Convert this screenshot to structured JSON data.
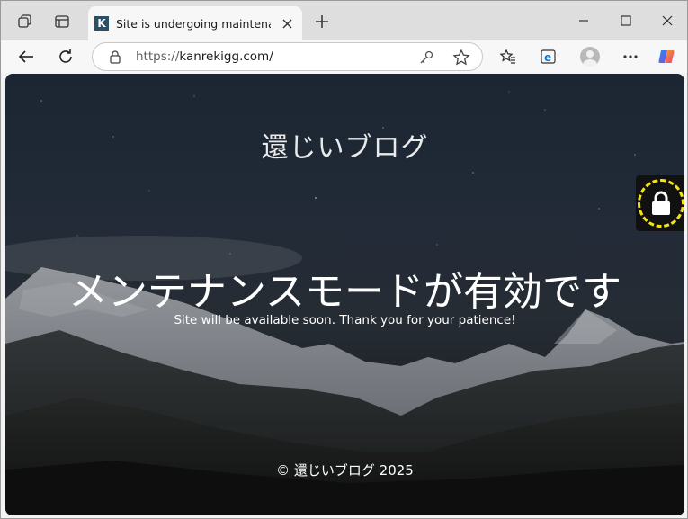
{
  "browser": {
    "tab": {
      "favicon_letter": "K",
      "title": "Site is undergoing maintenance"
    },
    "url_protocol": "https://",
    "url_host": "kanrekigg.com/"
  },
  "page": {
    "site_title": "還じいブログ",
    "headline": "メンテナンスモードが有効です",
    "subline": "Site will be available soon. Thank you for your patience!",
    "footer": "© 還じいブログ 2025"
  },
  "colors": {
    "lock_ring": "#f4e21b",
    "favicon_bg": "#2c4f66"
  }
}
